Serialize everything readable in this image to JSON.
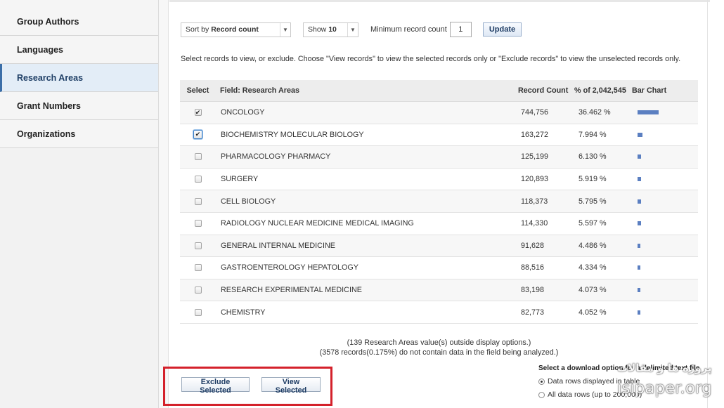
{
  "sidebar": {
    "items": [
      {
        "label": "Group Authors",
        "active": false
      },
      {
        "label": "Languages",
        "active": false
      },
      {
        "label": "Research Areas",
        "active": true
      },
      {
        "label": "Grant Numbers",
        "active": false
      },
      {
        "label": "Organizations",
        "active": false
      }
    ]
  },
  "controls": {
    "sort_prefix": "Sort by",
    "sort_value": "Record count",
    "show_prefix": "Show",
    "show_value": "10",
    "min_label": "Minimum record count",
    "min_value": "1",
    "update_label": "Update"
  },
  "instructions": "Select records to view, or exclude. Choose \"View records\" to view the selected records only or \"Exclude records\" to view the unselected records only.",
  "table": {
    "headers": {
      "select": "Select",
      "field": "Field: Research Areas",
      "count": "Record Count",
      "pct": "% of 2,042,545",
      "bar": "Bar Chart"
    },
    "rows": [
      {
        "field": "ONCOLOGY",
        "count": "744,756",
        "pct": "36.462 %",
        "share": 36.462,
        "checked": true
      },
      {
        "field": "BIOCHEMISTRY MOLECULAR BIOLOGY",
        "count": "163,272",
        "pct": "7.994 %",
        "share": 7.994,
        "checked": true,
        "focused": true
      },
      {
        "field": "PHARMACOLOGY PHARMACY",
        "count": "125,199",
        "pct": "6.130 %",
        "share": 6.13,
        "checked": false
      },
      {
        "field": "SURGERY",
        "count": "120,893",
        "pct": "5.919 %",
        "share": 5.919,
        "checked": false
      },
      {
        "field": "CELL BIOLOGY",
        "count": "118,373",
        "pct": "5.795 %",
        "share": 5.795,
        "checked": false
      },
      {
        "field": "RADIOLOGY NUCLEAR MEDICINE MEDICAL IMAGING",
        "count": "114,330",
        "pct": "5.597 %",
        "share": 5.597,
        "checked": false
      },
      {
        "field": "GENERAL INTERNAL MEDICINE",
        "count": "91,628",
        "pct": "4.486 %",
        "share": 4.486,
        "checked": false
      },
      {
        "field": "GASTROENTEROLOGY HEPATOLOGY",
        "count": "88,516",
        "pct": "4.334 %",
        "share": 4.334,
        "checked": false
      },
      {
        "field": "RESEARCH EXPERIMENTAL MEDICINE",
        "count": "83,198",
        "pct": "4.073 %",
        "share": 4.073,
        "checked": false
      },
      {
        "field": "CHEMISTRY",
        "count": "82,773",
        "pct": "4.052 %",
        "share": 4.052,
        "checked": false
      }
    ]
  },
  "notes": {
    "line1": "(139 Research Areas value(s) outside display options.)",
    "line2": "(3578 records(0.175%) do not contain data in the field being analyzed.)"
  },
  "actions": {
    "exclude_label": "Exclude Selected",
    "view_label": "View Selected"
  },
  "download": {
    "title": "Select a download option for a delimited text file",
    "options": [
      {
        "label": "Data rows displayed in table",
        "selected": true
      },
      {
        "label": "All data rows (up to 200,000)",
        "selected": false
      }
    ]
  },
  "watermark": {
    "persian": "پروژه ها و مقالات",
    "domain": "isipaper.org"
  },
  "colors": {
    "bar": "#5b7fc1",
    "highlight": "#d4212b",
    "active_side": "#e3edf7"
  }
}
